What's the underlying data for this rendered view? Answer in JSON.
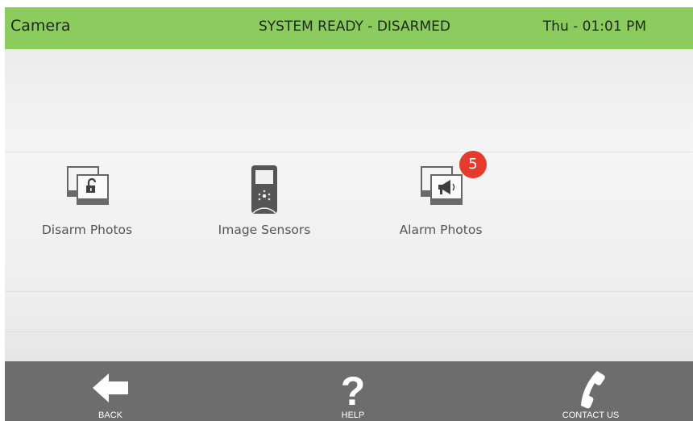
{
  "header": {
    "title": "Camera",
    "status": "SYSTEM READY - DISARMED",
    "clock": "Thu - 01:01 PM",
    "color": "#8ccb5e"
  },
  "tiles": [
    {
      "label": "Disarm Photos",
      "icon": "disarm-photos-icon"
    },
    {
      "label": "Image Sensors",
      "icon": "image-sensor-icon"
    },
    {
      "label": "Alarm Photos",
      "icon": "alarm-photos-icon",
      "badge": "5"
    }
  ],
  "footer": {
    "back": "BACK",
    "help": "HELP",
    "contact": "CONTACT US",
    "color": "#6d6d6d"
  }
}
